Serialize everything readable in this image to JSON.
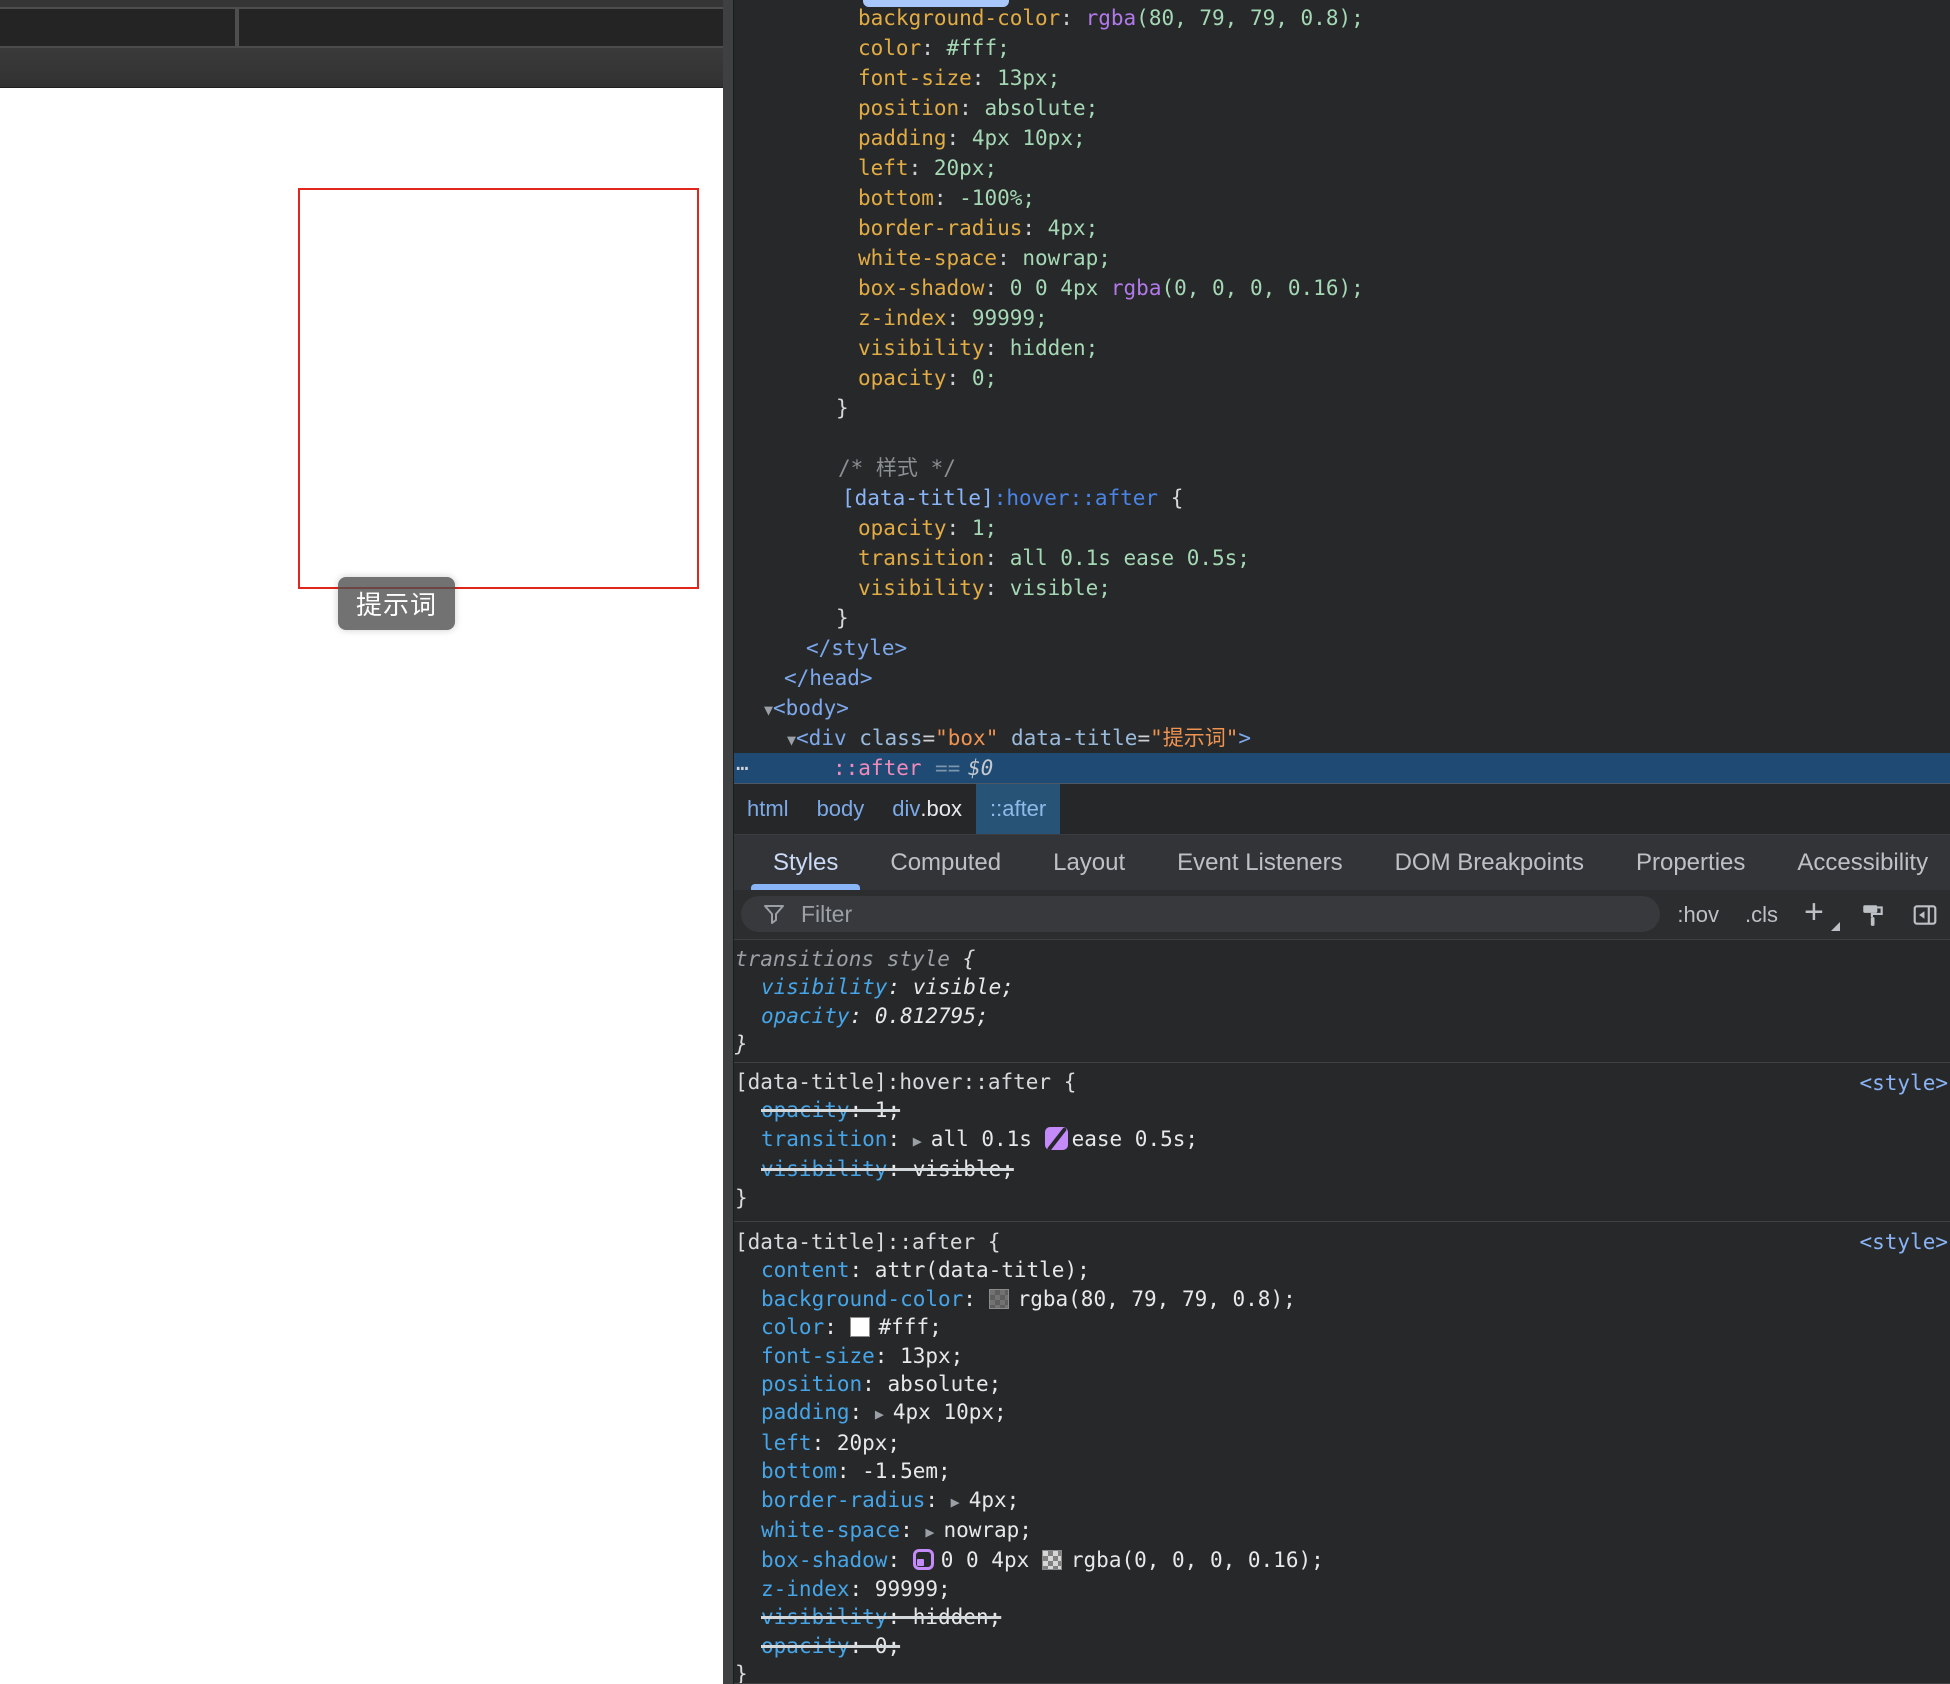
{
  "page": {
    "tooltip": {
      "text": "提示词",
      "bg": "rgba(80, 79, 79, 0.8)",
      "text_color": "#fff"
    },
    "box_border_color": "#e0261d"
  },
  "devtools": {
    "colors": {
      "selection_row_bg": "#1f4a73",
      "crumb_selected_bg": "#275377",
      "tab_underline": "#8ab4f8",
      "tree_property_gold": "#e2ac45",
      "tree_value_green": "#a5d8b5",
      "tree_tag_blue": "#7da8ec",
      "attr_value_orange": "#ef9350",
      "pseudo_pink": "#f08bbb",
      "styles_property_cyan": "#45a5e8",
      "swatch_purple": "#c58af9"
    },
    "tree": {
      "lines": [
        {
          "ind": 125,
          "segs": [
            [
              "background-color",
              "prop"
            ],
            [
              ": ",
              "punct"
            ],
            [
              "rgba",
              "fn"
            ],
            [
              "(80, 79, 79, 0.8)",
              "val"
            ],
            [
              ";",
              "val"
            ]
          ]
        },
        {
          "ind": 125,
          "segs": [
            [
              "color",
              "prop"
            ],
            [
              ": ",
              "punct"
            ],
            [
              "#fff;",
              "val"
            ]
          ]
        },
        {
          "ind": 125,
          "segs": [
            [
              "font-size",
              "prop"
            ],
            [
              ": ",
              "punct"
            ],
            [
              "13px;",
              "val"
            ]
          ]
        },
        {
          "ind": 125,
          "segs": [
            [
              "position",
              "prop"
            ],
            [
              ": ",
              "punct"
            ],
            [
              "absolute;",
              "val"
            ]
          ]
        },
        {
          "ind": 125,
          "segs": [
            [
              "padding",
              "prop"
            ],
            [
              ": ",
              "punct"
            ],
            [
              "4px 10px;",
              "val"
            ]
          ]
        },
        {
          "ind": 125,
          "segs": [
            [
              "left",
              "prop"
            ],
            [
              ": ",
              "punct"
            ],
            [
              "20px;",
              "val"
            ]
          ]
        },
        {
          "ind": 125,
          "segs": [
            [
              "bottom",
              "prop"
            ],
            [
              ": ",
              "punct"
            ],
            [
              "-100%;",
              "val"
            ]
          ]
        },
        {
          "ind": 125,
          "segs": [
            [
              "border-radius",
              "prop"
            ],
            [
              ": ",
              "punct"
            ],
            [
              "4px;",
              "val"
            ]
          ]
        },
        {
          "ind": 125,
          "segs": [
            [
              "white-space",
              "prop"
            ],
            [
              ": ",
              "punct"
            ],
            [
              "nowrap;",
              "val"
            ]
          ]
        },
        {
          "ind": 125,
          "segs": [
            [
              "box-shadow",
              "prop"
            ],
            [
              ": ",
              "punct"
            ],
            [
              "0 0 4px ",
              "val"
            ],
            [
              "rgba",
              "fn"
            ],
            [
              "(0, 0, 0, 0.16)",
              "val"
            ],
            [
              ";",
              "val"
            ]
          ]
        },
        {
          "ind": 125,
          "segs": [
            [
              "z-index",
              "prop"
            ],
            [
              ": ",
              "punct"
            ],
            [
              "99999;",
              "val"
            ]
          ]
        },
        {
          "ind": 125,
          "segs": [
            [
              "visibility",
              "prop"
            ],
            [
              ": ",
              "punct"
            ],
            [
              "hidden;",
              "val"
            ]
          ]
        },
        {
          "ind": 125,
          "segs": [
            [
              "opacity",
              "prop"
            ],
            [
              ": ",
              "punct"
            ],
            [
              "0;",
              "val"
            ]
          ]
        },
        {
          "ind": 103,
          "segs": [
            [
              "}",
              "brace"
            ]
          ]
        },
        {
          "ind": 103,
          "segs": []
        },
        {
          "ind": 105,
          "segs": [
            [
              "/* 样式 */",
              "comment"
            ]
          ]
        },
        {
          "ind": 109,
          "segs": [
            [
              "[data-title]",
              "selattr"
            ],
            [
              ":hover::after",
              "selpseudo"
            ],
            [
              " {",
              "brace"
            ]
          ]
        },
        {
          "ind": 125,
          "segs": [
            [
              "opacity",
              "prop"
            ],
            [
              ": ",
              "punct"
            ],
            [
              "1;",
              "val"
            ]
          ]
        },
        {
          "ind": 125,
          "segs": [
            [
              "transition",
              "prop"
            ],
            [
              ": ",
              "punct"
            ],
            [
              "all 0.1s ease 0.5s;",
              "val"
            ]
          ]
        },
        {
          "ind": 125,
          "segs": [
            [
              "visibility",
              "prop"
            ],
            [
              ": ",
              "punct"
            ],
            [
              "visible;",
              "val"
            ]
          ]
        },
        {
          "ind": 103,
          "segs": [
            [
              "}",
              "brace"
            ]
          ]
        },
        {
          "ind": 73,
          "segs": [
            [
              "</style>",
              "tag"
            ]
          ]
        },
        {
          "ind": 51,
          "segs": [
            [
              "</head>",
              "tag"
            ]
          ]
        },
        {
          "ind": 31,
          "segs": [
            [
              "▼",
              "arrow"
            ],
            [
              "<body>",
              "tag"
            ]
          ]
        },
        {
          "ind": 54,
          "segs": [
            [
              "▼",
              "arrow"
            ],
            [
              "<div ",
              "tag"
            ],
            [
              "class",
              "attr"
            ],
            [
              "=",
              "punct"
            ],
            [
              "\"box\"",
              "str"
            ],
            [
              " ",
              "punct"
            ],
            [
              "data-title",
              "attr"
            ],
            [
              "=",
              "punct"
            ],
            [
              "\"提示词\"",
              "str"
            ],
            [
              ">",
              "tag"
            ]
          ]
        }
      ],
      "selected_row": {
        "more": "⋯",
        "pseudo": "::after",
        "eq": "==",
        "ref": "$0"
      }
    },
    "crumbs": [
      {
        "segs": [
          [
            "html",
            "ctag"
          ]
        ]
      },
      {
        "segs": [
          [
            "body",
            "ctag"
          ]
        ]
      },
      {
        "segs": [
          [
            "div",
            "ctag"
          ],
          [
            ".box",
            "ccls"
          ]
        ]
      },
      {
        "segs": [
          [
            "::after",
            "cpseudo"
          ]
        ],
        "selected": true
      }
    ],
    "tabs": [
      {
        "label": "Styles",
        "active": true
      },
      {
        "label": "Computed"
      },
      {
        "label": "Layout"
      },
      {
        "label": "Event Listeners"
      },
      {
        "label": "DOM Breakpoints"
      },
      {
        "label": "Properties"
      },
      {
        "label": "Accessibility"
      }
    ],
    "styles_toolbar": {
      "filter_placeholder": "Filter",
      "hov_label": ":hov",
      "cls_label": ".cls",
      "plus_glyph": "+",
      "icons": [
        "filter-funnel-icon",
        "new-style-rule-plus-icon",
        "paint-roller-icon",
        "toggle-sidebar-icon"
      ]
    },
    "styles": {
      "sections": [
        {
          "italic": true,
          "selector": [
            [
              "transitions style",
              "secname"
            ],
            [
              " {",
              "sbrace"
            ]
          ],
          "link": null,
          "decls": [
            {
              "segs": [
                [
                  "visibility",
                  "sprop"
                ],
                [
                  ": ",
                  "sval"
                ],
                [
                  "visible;",
                  "sval"
                ]
              ]
            },
            {
              "segs": [
                [
                  "opacity",
                  "sprop"
                ],
                [
                  ": ",
                  "sval"
                ],
                [
                  "0.812795;",
                  "sval"
                ]
              ]
            }
          ]
        },
        {
          "selector": [
            [
              "[data-title]:hover::after",
              "ssel"
            ],
            [
              " {",
              "sbrace"
            ]
          ],
          "link": "<style>",
          "decls": [
            {
              "struck": true,
              "segs": [
                [
                  "opacity",
                  "sprop"
                ],
                [
                  ": 1;",
                  "sval"
                ]
              ]
            },
            {
              "segs": [
                [
                  "transition",
                  "sprop"
                ],
                [
                  ": ",
                  "sval"
                ],
                [
                  "▶ ",
                  "arrow"
                ],
                [
                  "all 0.1s ",
                  "sval"
                ],
                [
                  "",
                  "icon-bezier"
                ],
                [
                  "ease 0.5s;",
                  "sval"
                ]
              ]
            },
            {
              "struck": true,
              "segs": [
                [
                  "visibility",
                  "sprop"
                ],
                [
                  ": visible;",
                  "sval"
                ]
              ]
            }
          ]
        },
        {
          "selector": [
            [
              "[data-title]::after",
              "ssel"
            ],
            [
              " {",
              "sbrace"
            ]
          ],
          "link": "<style>",
          "decls": [
            {
              "segs": [
                [
                  "content",
                  "sprop"
                ],
                [
                  ": attr(data-title);",
                  "sval"
                ]
              ]
            },
            {
              "segs": [
                [
                  "background-color",
                  "sprop"
                ],
                [
                  ": ",
                  "sval"
                ],
                [
                  "",
                  "swatch-checker",
                  "rgba(80, 79, 79, 0.8)"
                ],
                [
                  "rgba(80, 79, 79, 0.8);",
                  "sval"
                ]
              ]
            },
            {
              "segs": [
                [
                  "color",
                  "sprop"
                ],
                [
                  ": ",
                  "sval"
                ],
                [
                  "",
                  "swatch-solid",
                  "#ffffff"
                ],
                [
                  "#fff;",
                  "sval"
                ]
              ]
            },
            {
              "segs": [
                [
                  "font-size",
                  "sprop"
                ],
                [
                  ": 13px;",
                  "sval"
                ]
              ]
            },
            {
              "segs": [
                [
                  "position",
                  "sprop"
                ],
                [
                  ": absolute;",
                  "sval"
                ]
              ]
            },
            {
              "segs": [
                [
                  "padding",
                  "sprop"
                ],
                [
                  ": ",
                  "sval"
                ],
                [
                  "▶ ",
                  "arrow"
                ],
                [
                  "4px 10px;",
                  "sval"
                ]
              ]
            },
            {
              "segs": [
                [
                  "left",
                  "sprop"
                ],
                [
                  ": 20px;",
                  "sval"
                ]
              ]
            },
            {
              "segs": [
                [
                  "bottom",
                  "sprop"
                ],
                [
                  ": -1.5em;",
                  "sval"
                ]
              ]
            },
            {
              "segs": [
                [
                  "border-radius",
                  "sprop"
                ],
                [
                  ": ",
                  "sval"
                ],
                [
                  "▶ ",
                  "arrow"
                ],
                [
                  "4px;",
                  "sval"
                ]
              ]
            },
            {
              "segs": [
                [
                  "white-space",
                  "sprop"
                ],
                [
                  ": ",
                  "sval"
                ],
                [
                  "▶ ",
                  "arrow"
                ],
                [
                  "nowrap;",
                  "sval"
                ]
              ]
            },
            {
              "segs": [
                [
                  "box-shadow",
                  "sprop"
                ],
                [
                  ": ",
                  "sval"
                ],
                [
                  "",
                  "icon-shadow"
                ],
                [
                  "0 0 4px ",
                  "sval"
                ],
                [
                  "",
                  "swatch-checker",
                  "rgba(0, 0, 0, 0.16)"
                ],
                [
                  "rgba(0, 0, 0, 0.16);",
                  "sval"
                ]
              ]
            },
            {
              "segs": [
                [
                  "z-index",
                  "sprop"
                ],
                [
                  ": 99999;",
                  "sval"
                ]
              ]
            },
            {
              "struck": true,
              "segs": [
                [
                  "visibility",
                  "sprop"
                ],
                [
                  ": hidden;",
                  "sval"
                ]
              ]
            },
            {
              "struck": true,
              "segs": [
                [
                  "opacity",
                  "sprop"
                ],
                [
                  ": 0;",
                  "sval"
                ]
              ]
            }
          ]
        }
      ]
    }
  }
}
